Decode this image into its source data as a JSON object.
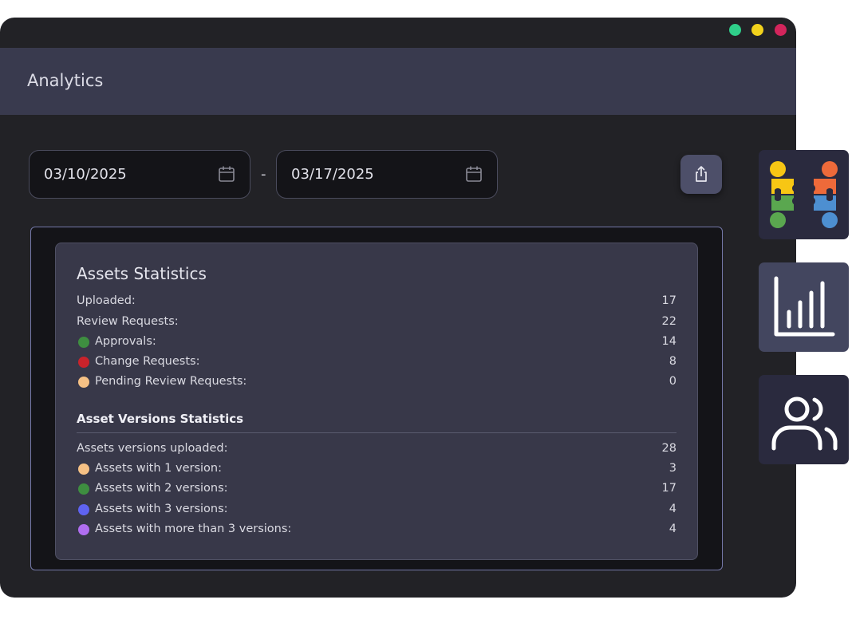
{
  "window": {
    "controls": [
      {
        "name": "green-dot",
        "color": "#2fcf8a"
      },
      {
        "name": "yellow-dot",
        "color": "#f2d21c"
      },
      {
        "name": "red-dot",
        "color": "#d3255c"
      }
    ]
  },
  "header": {
    "title": "Analytics"
  },
  "date_range": {
    "start": "03/10/2025",
    "separator": "-",
    "end": "03/17/2025",
    "icon": "calendar-icon"
  },
  "export_button": {
    "icon": "share-upload-icon"
  },
  "assets_statistics": {
    "title": "Assets Statistics",
    "rows": [
      {
        "label": "Uploaded:",
        "value": "17"
      },
      {
        "label": "Review Requests:",
        "value": "22"
      },
      {
        "label": "Approvals:",
        "value": "14",
        "color": "#3e8e40"
      },
      {
        "label": "Change Requests:",
        "value": "8",
        "color": "#c9232b"
      },
      {
        "label": "Pending Review Requests:",
        "value": "0",
        "color": "#f6c185"
      }
    ]
  },
  "asset_versions_statistics": {
    "title": "Asset Versions Statistics",
    "rows": [
      {
        "label": "Assets versions uploaded:",
        "value": "28"
      },
      {
        "label": "Assets with 1 version:",
        "value": "3",
        "color": "#f6c185"
      },
      {
        "label": "Assets with 2 versions:",
        "value": "17",
        "color": "#3e8e40"
      },
      {
        "label": "Assets with 3 versions:",
        "value": "4",
        "color": "#5f63f2"
      },
      {
        "label": "Assets with more than 3 versions:",
        "value": "4",
        "color": "#b06ef0"
      }
    ]
  },
  "side_tiles": [
    {
      "name": "collaboration-puzzle-tile",
      "icon": "puzzle-people-icon",
      "background": "#2a2a3e"
    },
    {
      "name": "analytics-tile",
      "icon": "bar-chart-icon",
      "background": "#43465f"
    },
    {
      "name": "users-tile",
      "icon": "users-icon",
      "background": "#2a2a3e"
    }
  ]
}
